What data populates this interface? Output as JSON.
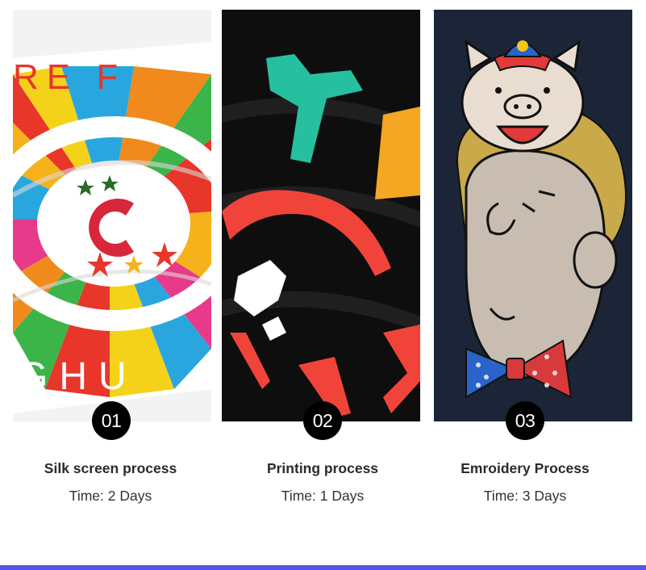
{
  "processes": [
    {
      "number": "01",
      "title": "Silk screen process",
      "time": "Time: 2 Days"
    },
    {
      "number": "02",
      "title": "Printing process",
      "time": "Time: 1 Days"
    },
    {
      "number": "03",
      "title": "Emroidery Process",
      "time": "Time: 3 Days"
    }
  ],
  "photo_text": {
    "p1_top": "RE F",
    "p1_bottom": "GHU"
  },
  "colors": {
    "accent_bar": "#5a55e0",
    "badge": "#000000"
  }
}
